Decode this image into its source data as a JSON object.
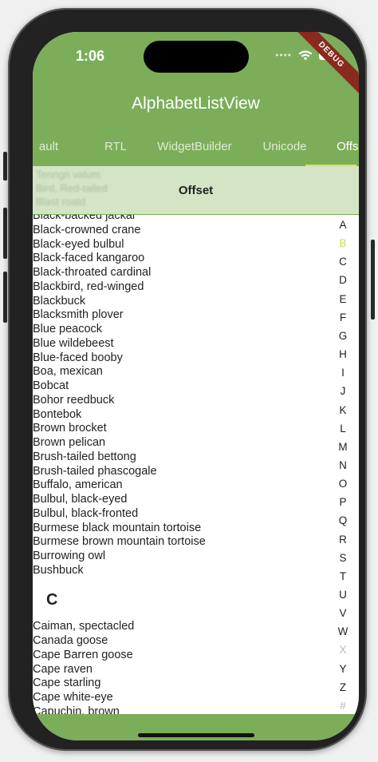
{
  "status": {
    "time": "1:06",
    "dots": "••••"
  },
  "debug_banner": "DEBUG",
  "app": {
    "title": "AlphabetListView"
  },
  "tabs": [
    {
      "label": "ault"
    },
    {
      "label": "RTL"
    },
    {
      "label": "WidgetBuilder"
    },
    {
      "label": "Unicode"
    },
    {
      "label": "Offset"
    }
  ],
  "sticky": {
    "title": "Offset",
    "ghost_lines": [
      "Tenngn valum",
      "Bird, Red-tailed",
      "Blast roatd"
    ]
  },
  "list_b": [
    "Black-backed jackal",
    "Black-crowned crane",
    "Black-eyed bulbul",
    "Black-faced kangaroo",
    "Black-throated cardinal",
    "Blackbird, red-winged",
    "Blackbuck",
    "Blacksmith plover",
    "Blue peacock",
    "Blue wildebeest",
    "Blue-faced booby",
    "Boa, mexican",
    "Bobcat",
    "Bohor reedbuck",
    "Bontebok",
    "Brown brocket",
    "Brown pelican",
    "Brush-tailed bettong",
    "Brush-tailed phascogale",
    "Buffalo, american",
    "Bulbul, black-eyed",
    "Bulbul, black-fronted",
    "Burmese black mountain tortoise",
    "Burmese brown mountain tortoise",
    "Burrowing owl",
    "Bushbuck"
  ],
  "section_c": "C",
  "list_c": [
    "Caiman, spectacled",
    "Canada goose",
    "Cape Barren goose",
    "Cape raven",
    "Cape starling",
    "Cape white-eye",
    "Capuchin, brown"
  ],
  "alphabet": [
    "A",
    "B",
    "C",
    "D",
    "E",
    "F",
    "G",
    "H",
    "I",
    "J",
    "K",
    "L",
    "M",
    "N",
    "O",
    "P",
    "Q",
    "R",
    "S",
    "T",
    "U",
    "V",
    "W",
    "X",
    "Y",
    "Z",
    "#"
  ],
  "alphabet_highlight": "B",
  "alphabet_muted": [
    "X",
    "#"
  ],
  "colors": {
    "primary": "#7cae5a",
    "header": "#d3e5c4",
    "indicator": "#d8e34a",
    "selected_letter": "#c8dc52"
  }
}
